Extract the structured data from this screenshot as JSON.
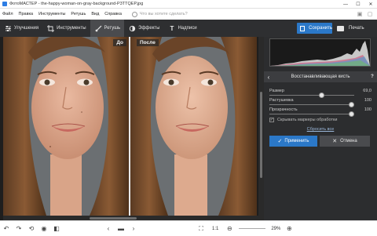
{
  "window": {
    "title": "ФотоМАСТЕР - the-happy-woman-on-gray-background-P3TTQEP.jpg",
    "controls": [
      "—",
      "☐",
      "✕"
    ]
  },
  "menu": {
    "items": [
      "Файл",
      "Правка",
      "Инструменты",
      "Ретушь",
      "Вид",
      "Справка"
    ],
    "search_placeholder": "Что вы хотите сделать?"
  },
  "toolbar": {
    "tabs": [
      {
        "label": "Улучшения",
        "icon": "sliders-icon",
        "active": false
      },
      {
        "label": "Инструменты",
        "icon": "crop-icon",
        "active": false
      },
      {
        "label": "Ретушь",
        "icon": "brush-icon",
        "active": true
      },
      {
        "label": "Эффекты",
        "icon": "effects-icon",
        "active": false
      },
      {
        "label": "Надписи",
        "icon": "text-icon",
        "active": false
      }
    ],
    "save_label": "Сохранить",
    "print_label": "Печать"
  },
  "canvas": {
    "before_label": "До",
    "after_label": "После"
  },
  "panel": {
    "title": "Восстанавливающая кисть",
    "help": "?",
    "sliders": [
      {
        "label": "Размер",
        "value": "69,0",
        "level": 0.62
      },
      {
        "label": "Растушевка",
        "value": "100",
        "level": 1.0
      },
      {
        "label": "Прозрачность",
        "value": "100",
        "level": 1.0
      }
    ],
    "checkbox_label": "Скрывать маркеры обработки",
    "reset_label": "Сбросить все",
    "apply_label": "Применить",
    "cancel_label": "Отмена"
  },
  "status": {
    "ratio": "1:1",
    "zoom": "29%"
  },
  "colors": {
    "accent": "#2b78c8",
    "toolbar_bg": "#2e2f31",
    "panel_bg": "#2c2d2f"
  }
}
